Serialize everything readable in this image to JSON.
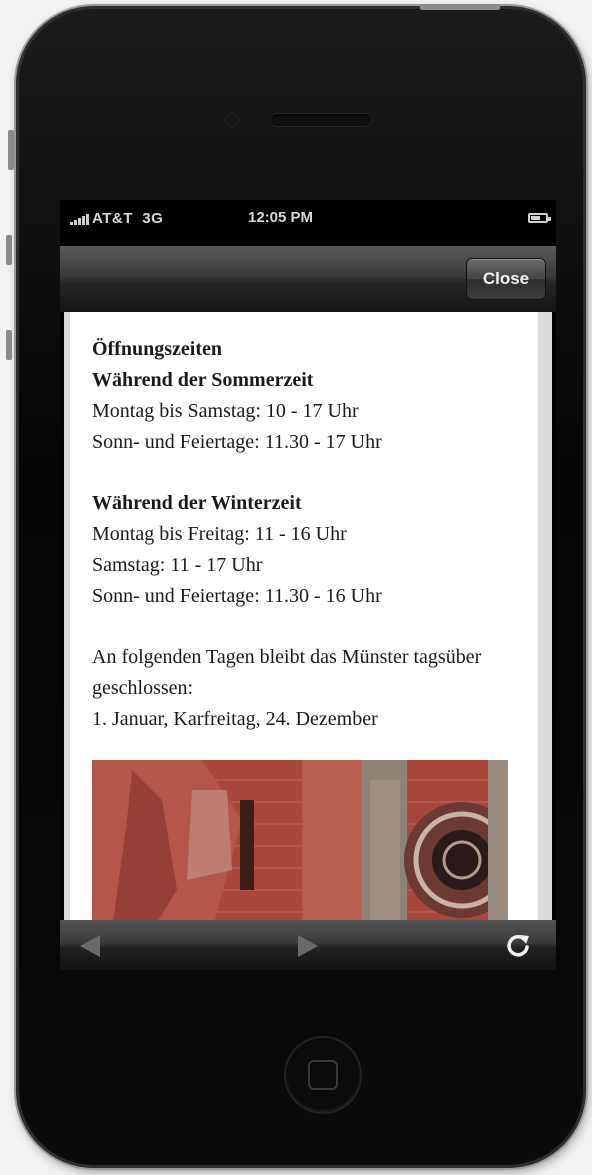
{
  "status_bar": {
    "carrier": "AT&T",
    "network": "3G",
    "time": "12:05 PM"
  },
  "toolbar": {
    "close_label": "Close"
  },
  "content": {
    "heading": "Öffnungszeiten",
    "summer_heading": "Während der Sommerzeit",
    "summer_line1": "Montag bis Samstag: 10 - 17 Uhr",
    "summer_line2": "Sonn- und Feiertage: 11.30 - 17 Uhr",
    "winter_heading": "Während der Winterzeit",
    "winter_line1": "Montag bis Freitag: 11 - 16 Uhr",
    "winter_line2": "Samstag: 11 - 17 Uhr",
    "winter_line3": "Sonn- und Feiertage: 11.30 - 16 Uhr",
    "closed_text": "An folgenden Tagen bleibt das Münster tagsüber geschlossen:",
    "closed_days": "1. Januar, Karfreitag, 24. Dezember"
  },
  "icons": {
    "back": "back-arrow-icon",
    "forward": "forward-arrow-icon",
    "reload": "reload-icon"
  },
  "colors": {
    "phone_body": "#0a0a0a",
    "toolbar": "#2a2a2a",
    "sandstone": "#a7453c"
  }
}
